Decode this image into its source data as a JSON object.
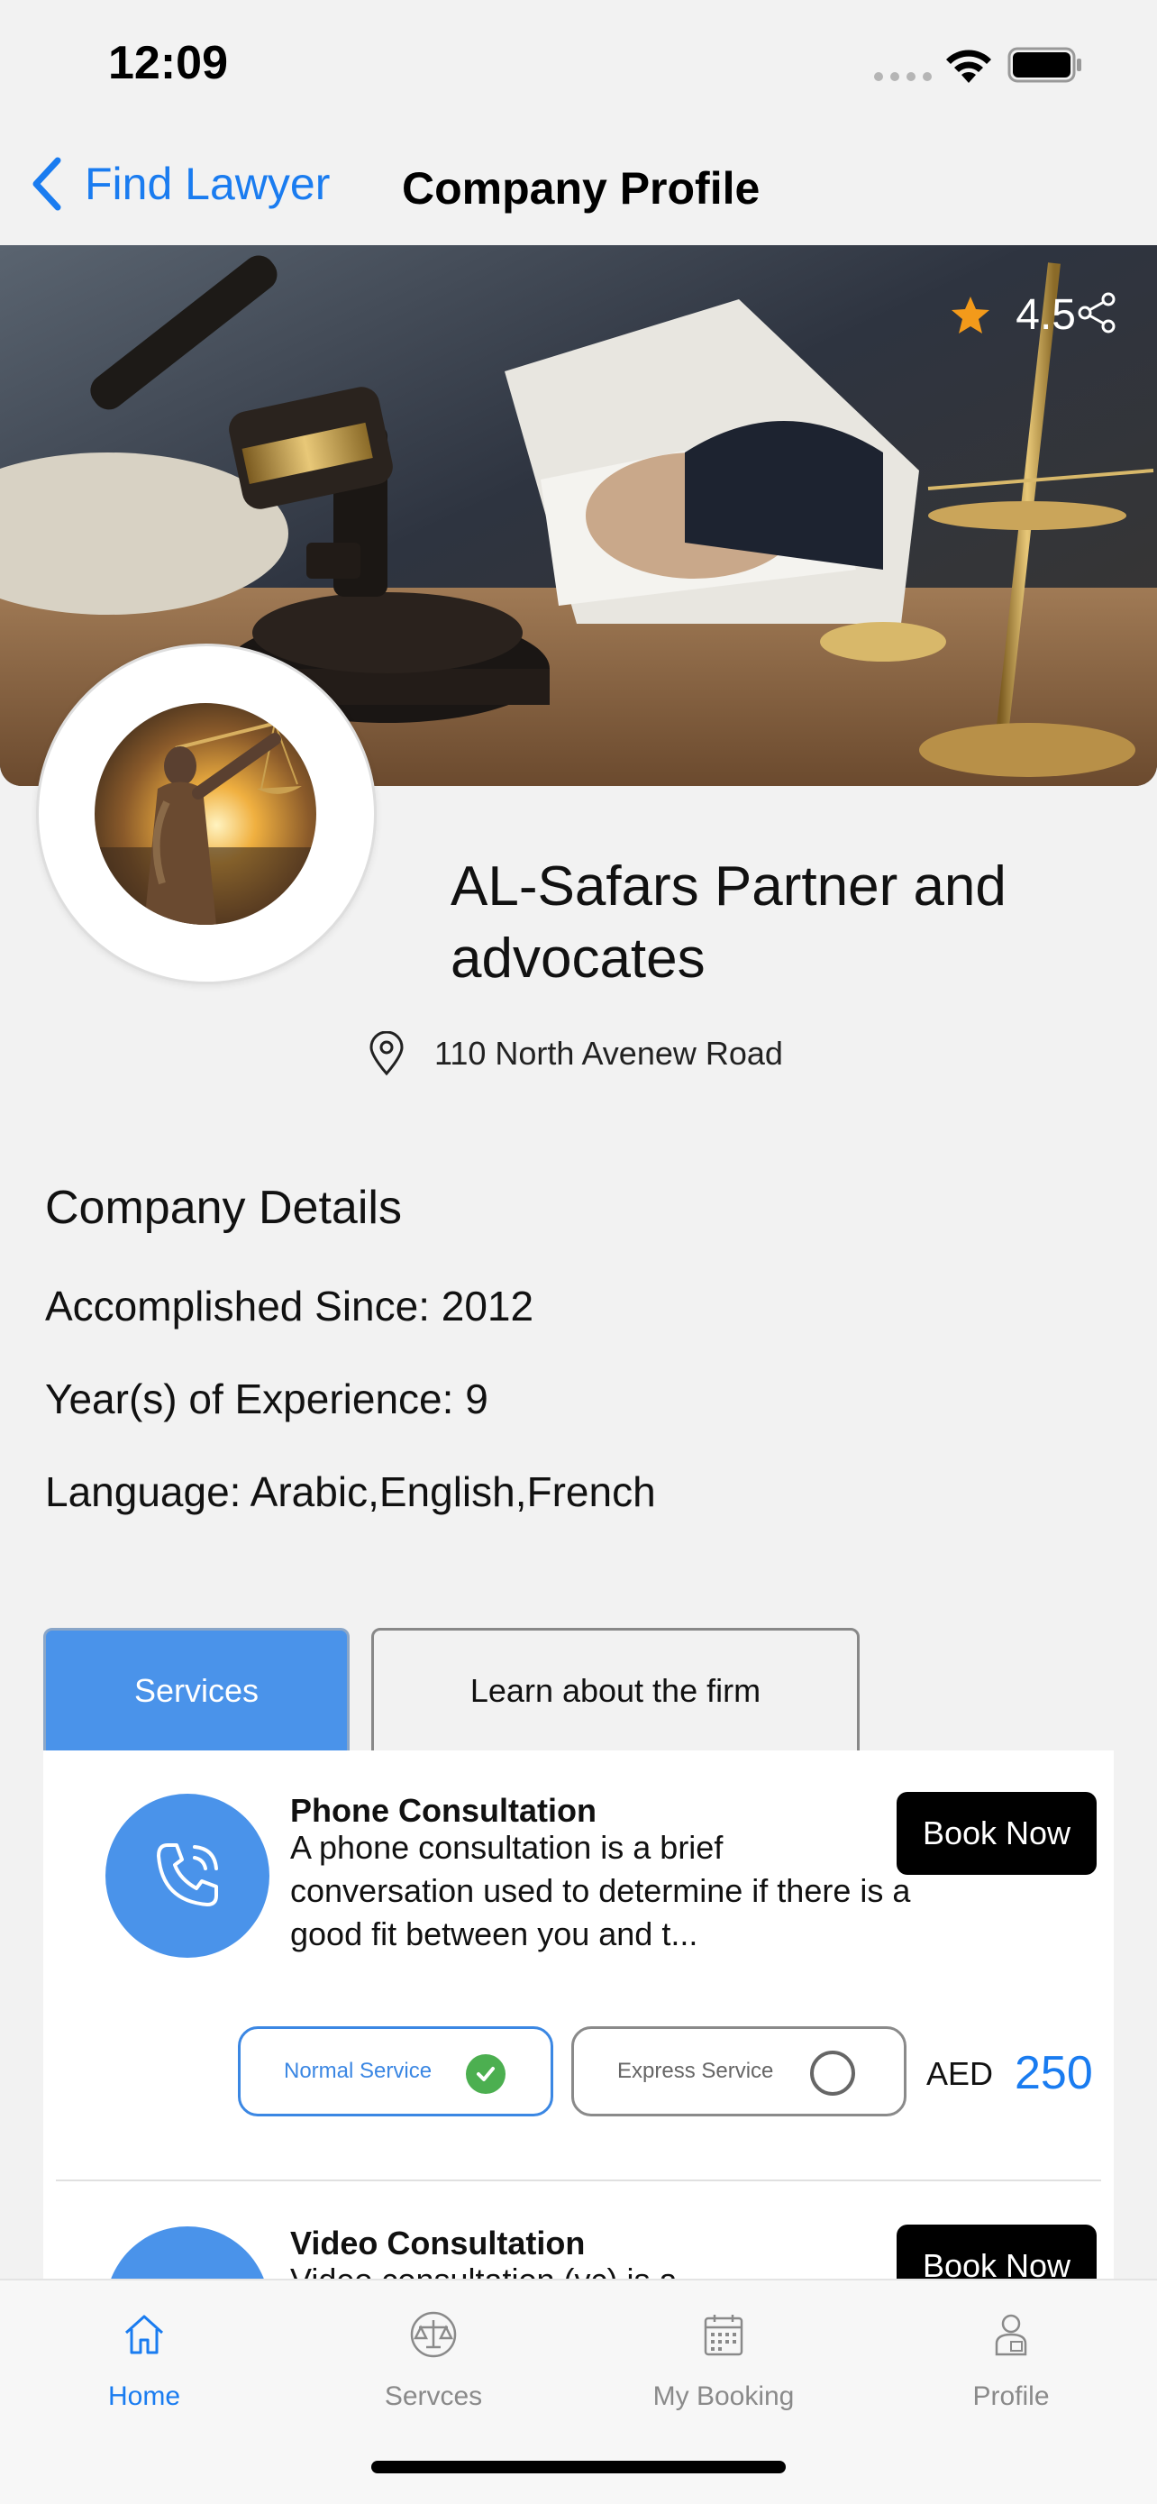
{
  "status_bar": {
    "time": "12:09"
  },
  "nav": {
    "back_label": "Find Lawyer",
    "title": "Company Profile"
  },
  "hero": {
    "rating": "4.5"
  },
  "company": {
    "name": "AL-Safars Partner and advocates",
    "address": "110 North Avenew Road"
  },
  "details": {
    "heading": "Company Details",
    "accomplished": "Accomplished Since: 2012",
    "experience": "Year(s) of Experience: 9",
    "language": "Language: Arabic,English,French"
  },
  "tabs": {
    "services": "Services",
    "learn": "Learn about the firm"
  },
  "services": [
    {
      "title": "Phone Consultation",
      "description": "A phone consultation is a brief conversation used to determine if there is a good fit between you and t...",
      "book_label": "Book Now",
      "normal_label": "Normal Service",
      "express_label": "Express Service",
      "selected": "normal",
      "currency": "AED",
      "price": "250"
    },
    {
      "title": "Video Consultation",
      "description": "Video consultation (vc) is a",
      "book_label": "Book Now"
    }
  ],
  "tab_bar": {
    "home": "Home",
    "services": "Servces",
    "booking": "My Booking",
    "profile": "Profile",
    "active": "home"
  },
  "colors": {
    "accent": "#1a7cf0",
    "service_blue": "#4a93ea",
    "check_green": "#4caf50",
    "star_orange": "#f39a1a"
  }
}
